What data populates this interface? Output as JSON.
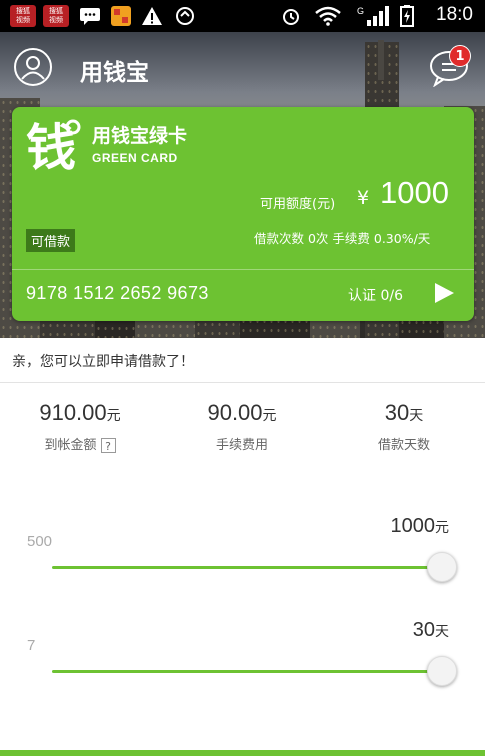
{
  "status_bar": {
    "notifications": [
      {
        "line1": "搜狐",
        "line2": "视频"
      },
      {
        "line1": "搜狐",
        "line2": "视频"
      }
    ],
    "icons": [
      "message-icon",
      "app-icon",
      "warning-icon",
      "data-sync-icon",
      "alarm-icon",
      "wifi-icon",
      "signal-icon",
      "battery-icon"
    ],
    "time": "18:0"
  },
  "header": {
    "title": "用钱宝",
    "message_badge": "1"
  },
  "card": {
    "logo_icon": "qian-logo-icon",
    "name": "用钱宝绿卡",
    "subtitle": "GREEN CARD",
    "credit_label": "可用额度(元)",
    "currency": "¥",
    "credit_amount": "1000",
    "borrow_tag": "可借款",
    "count_info": "借款次数 0次   手续费 0.30%/天",
    "card_number": "9178 1512 2652 9673",
    "verify": "认证 0/6",
    "accent_color": "#6dc232"
  },
  "prompt": {
    "text": "亲，您可以立即申请借款了！"
  },
  "stats": [
    {
      "value": "910.00",
      "unit": "元",
      "label": "到帐金额",
      "help": "?"
    },
    {
      "value": "90.00",
      "unit": "元",
      "label": "手续费用"
    },
    {
      "value": "30",
      "unit": "天",
      "label": "借款天数"
    }
  ],
  "sliders": [
    {
      "min_label": "500",
      "value": "1000",
      "unit": "元",
      "fraction": 1.0
    },
    {
      "min_label": "7",
      "value": "30",
      "unit": "天",
      "fraction": 1.0
    }
  ]
}
